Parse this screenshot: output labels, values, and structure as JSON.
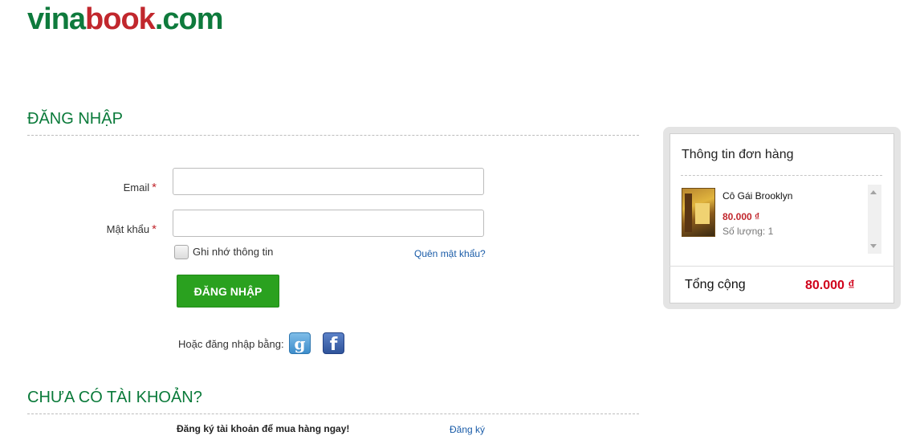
{
  "logo": {
    "part1": "vina",
    "part2": "book",
    "part3": ".com"
  },
  "login": {
    "title": "ĐĂNG NHẬP",
    "email_label": "Email",
    "password_label": "Mật khẩu",
    "required_mark": "*",
    "email_value": "",
    "password_value": "",
    "remember_label": "Ghi nhớ thông tin",
    "forgot_link": "Quên mật khẩu?",
    "submit_label": "ĐĂNG NHẬP",
    "social_label": "Hoặc đăng nhập bằng:",
    "google_glyph": "g",
    "facebook_glyph": "f"
  },
  "register": {
    "title": "CHƯA CÓ TÀI KHOẢN?",
    "text": "Đăng ký tài khoản để mua hàng ngay!",
    "link": "Đăng ký"
  },
  "order": {
    "title": "Thông tin đơn hàng",
    "items": [
      {
        "title": "Cô Gái Brooklyn",
        "price": "80.000 ₫",
        "quantity": "Số lượng: 1"
      }
    ],
    "total_label": "Tổng cộng",
    "total_value": "80.000 ₫"
  },
  "colors": {
    "brand_green": "#0e7a3c",
    "brand_red": "#c1272d",
    "button_green": "#2aa11f",
    "link_blue": "#1a5ca8"
  }
}
